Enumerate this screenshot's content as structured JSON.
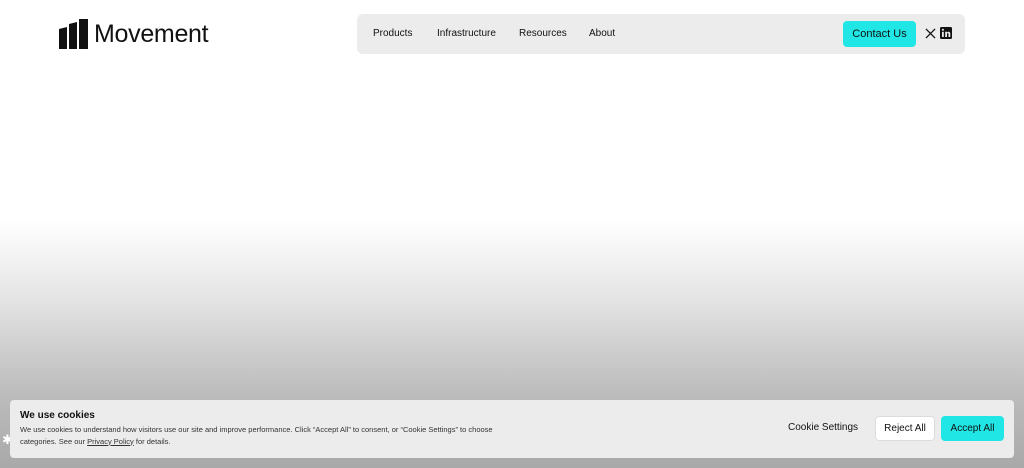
{
  "header": {
    "logo_text": "Movement",
    "logo_icon": "movement-logo-mark"
  },
  "nav": {
    "items": [
      {
        "label": "Products"
      },
      {
        "label": "Infrastructure"
      },
      {
        "label": "Resources"
      },
      {
        "label": "About"
      }
    ],
    "contact_label": "Contact Us",
    "social_icons": [
      "x-icon",
      "linkedin-icon"
    ]
  },
  "cookie": {
    "title": "We use cookies",
    "body_before_link": "We use cookies to understand how visitors use our site and improve performance. Click “Accept All” to consent, or “Cookie Settings” to choose categories. See our ",
    "privacy_link": "Privacy Policy",
    "body_after_link": " for details.",
    "settings_label": "Cookie Settings",
    "reject_label": "Reject All",
    "accept_label": "Accept All"
  },
  "colors": {
    "accent": "#21e6e6",
    "nav_bg": "#ececec",
    "text": "#111111"
  }
}
